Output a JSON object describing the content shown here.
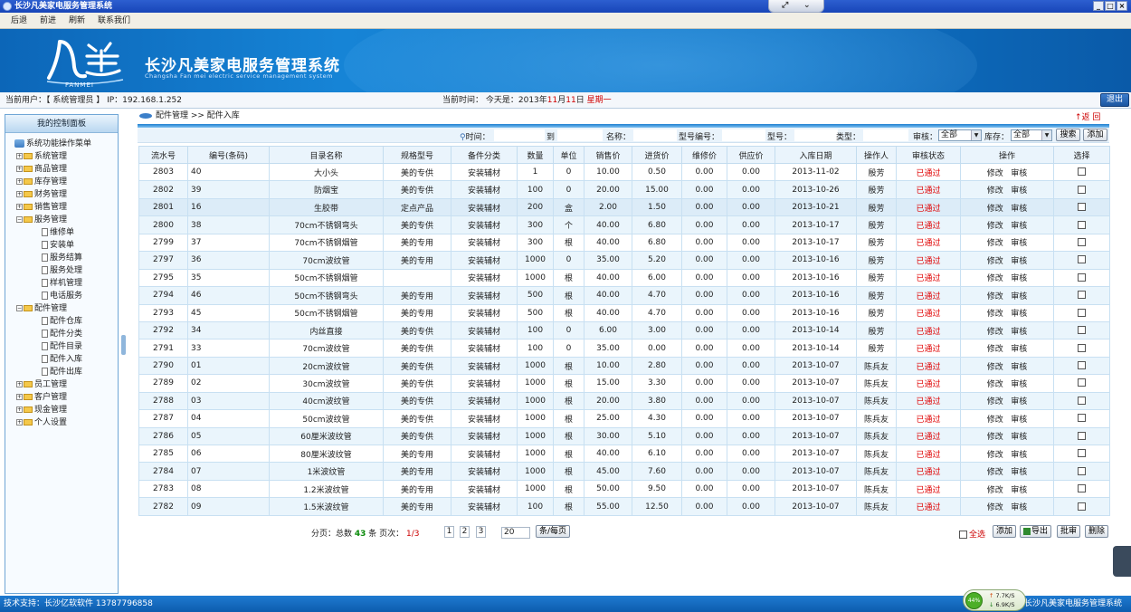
{
  "window": {
    "title": "长沙凡美家电服务管理系统",
    "controls": [
      "_",
      "□",
      "×"
    ]
  },
  "menu": [
    "后退",
    "前进",
    "刷新",
    "联系我们"
  ],
  "banner": {
    "logo_text": "凡美",
    "logo_sub": "FANMEI",
    "title": "长沙凡美家电服务管理系统",
    "subtitle": "Changsha Fan mei electric service management system"
  },
  "info": {
    "user_label": "当前用户：【 系统管理员 】 IP：192.168.1.252",
    "time_prefix": "当前时间：   今天是：2013年",
    "month": "11",
    "mid": "月",
    "day": "11",
    "suffix": "日",
    "weekday": "星期一",
    "logout": "退出"
  },
  "sidebar": {
    "header": "我的控制面板",
    "root": "系统功能操作菜单",
    "groups": [
      {
        "label": "系统管理",
        "expanded": false
      },
      {
        "label": "商品管理",
        "expanded": false
      },
      {
        "label": "库存管理",
        "expanded": false
      },
      {
        "label": "财务管理",
        "expanded": false
      },
      {
        "label": "销售管理",
        "expanded": false
      },
      {
        "label": "服务管理",
        "expanded": true,
        "children": [
          "维修单",
          "安装单",
          "服务结算",
          "服务处理",
          "样机管理",
          "电话服务"
        ]
      },
      {
        "label": "配件管理",
        "expanded": true,
        "children": [
          "配件仓库",
          "配件分类",
          "配件目录",
          "配件入库",
          "配件出库"
        ]
      },
      {
        "label": "员工管理",
        "expanded": false
      },
      {
        "label": "客户管理",
        "expanded": false
      },
      {
        "label": "现金管理",
        "expanded": false
      },
      {
        "label": "个人设置",
        "expanded": false
      }
    ]
  },
  "breadcrumb": "配件管理 >> 配件入库",
  "back": "↑返 回",
  "filters": {
    "time_label": "时间：",
    "to_label": "到",
    "name_label": "名称：",
    "model_no_label": "型号编号：",
    "model_label": "型号：",
    "type_label": "类型：",
    "audit_label": "审核：",
    "audit_value": "全部",
    "stock_label": "库存：",
    "stock_value": "全部",
    "search_btn": "搜索",
    "add_btn": "添加"
  },
  "table": {
    "columns": [
      "流水号",
      "编号(条码)",
      "目录名称",
      "规格型号",
      "备件分类",
      "数量",
      "单位",
      "销售价",
      "进货价",
      "维修价",
      "供应价",
      "入库日期",
      "操作人",
      "审核状态",
      "操作",
      "选择"
    ],
    "rows": [
      [
        "2803",
        "40",
        "大小头",
        "美的专供",
        "安装辅材",
        "1",
        "0",
        "10.00",
        "0.50",
        "0.00",
        "0.00",
        "2013-11-02",
        "殷芳",
        "已通过"
      ],
      [
        "2802",
        "39",
        "防烟宝",
        "美的专供",
        "安装辅材",
        "100",
        "0",
        "20.00",
        "15.00",
        "0.00",
        "0.00",
        "2013-10-26",
        "殷芳",
        "已通过"
      ],
      [
        "2801",
        "16",
        "生胶带",
        "定点产品",
        "安装辅材",
        "200",
        "盒",
        "2.00",
        "1.50",
        "0.00",
        "0.00",
        "2013-10-21",
        "殷芳",
        "已通过"
      ],
      [
        "2800",
        "38",
        "70cm不锈钢弯头",
        "美的专供",
        "安装辅材",
        "300",
        "个",
        "40.00",
        "6.80",
        "0.00",
        "0.00",
        "2013-10-17",
        "殷芳",
        "已通过"
      ],
      [
        "2799",
        "37",
        "70cm不锈钢烟管",
        "美的专用",
        "安装辅材",
        "300",
        "根",
        "40.00",
        "6.80",
        "0.00",
        "0.00",
        "2013-10-17",
        "殷芳",
        "已通过"
      ],
      [
        "2797",
        "36",
        "70cm波纹管",
        "美的专用",
        "安装辅材",
        "1000",
        "0",
        "35.00",
        "5.20",
        "0.00",
        "0.00",
        "2013-10-16",
        "殷芳",
        "已通过"
      ],
      [
        "2795",
        "35",
        "50cm不锈钢烟管",
        "",
        "安装辅材",
        "1000",
        "根",
        "40.00",
        "6.00",
        "0.00",
        "0.00",
        "2013-10-16",
        "殷芳",
        "已通过"
      ],
      [
        "2794",
        "46",
        "50cm不锈钢弯头",
        "美的专用",
        "安装辅材",
        "500",
        "根",
        "40.00",
        "4.70",
        "0.00",
        "0.00",
        "2013-10-16",
        "殷芳",
        "已通过"
      ],
      [
        "2793",
        "45",
        "50cm不锈钢烟管",
        "美的专用",
        "安装辅材",
        "500",
        "根",
        "40.00",
        "4.70",
        "0.00",
        "0.00",
        "2013-10-16",
        "殷芳",
        "已通过"
      ],
      [
        "2792",
        "34",
        "内丝直接",
        "美的专供",
        "安装辅材",
        "100",
        "0",
        "6.00",
        "3.00",
        "0.00",
        "0.00",
        "2013-10-14",
        "殷芳",
        "已通过"
      ],
      [
        "2791",
        "33",
        "70cm波纹管",
        "美的专供",
        "安装辅材",
        "100",
        "0",
        "35.00",
        "0.00",
        "0.00",
        "0.00",
        "2013-10-14",
        "殷芳",
        "已通过"
      ],
      [
        "2790",
        "01",
        "20cm波纹管",
        "美的专供",
        "安装辅材",
        "1000",
        "根",
        "10.00",
        "2.80",
        "0.00",
        "0.00",
        "2013-10-07",
        "陈兵友",
        "已通过"
      ],
      [
        "2789",
        "02",
        "30cm波纹管",
        "美的专供",
        "安装辅材",
        "1000",
        "根",
        "15.00",
        "3.30",
        "0.00",
        "0.00",
        "2013-10-07",
        "陈兵友",
        "已通过"
      ],
      [
        "2788",
        "03",
        "40cm波纹管",
        "美的专供",
        "安装辅材",
        "1000",
        "根",
        "20.00",
        "3.80",
        "0.00",
        "0.00",
        "2013-10-07",
        "陈兵友",
        "已通过"
      ],
      [
        "2787",
        "04",
        "50cm波纹管",
        "美的专供",
        "安装辅材",
        "1000",
        "根",
        "25.00",
        "4.30",
        "0.00",
        "0.00",
        "2013-10-07",
        "陈兵友",
        "已通过"
      ],
      [
        "2786",
        "05",
        "60厘米波纹管",
        "美的专供",
        "安装辅材",
        "1000",
        "根",
        "30.00",
        "5.10",
        "0.00",
        "0.00",
        "2013-10-07",
        "陈兵友",
        "已通过"
      ],
      [
        "2785",
        "06",
        "80厘米波纹管",
        "美的专用",
        "安装辅材",
        "1000",
        "根",
        "40.00",
        "6.10",
        "0.00",
        "0.00",
        "2013-10-07",
        "陈兵友",
        "已通过"
      ],
      [
        "2784",
        "07",
        "1米波纹管",
        "美的专用",
        "安装辅材",
        "1000",
        "根",
        "45.00",
        "7.60",
        "0.00",
        "0.00",
        "2013-10-07",
        "陈兵友",
        "已通过"
      ],
      [
        "2783",
        "08",
        "1.2米波纹管",
        "美的专用",
        "安装辅材",
        "1000",
        "根",
        "50.00",
        "9.50",
        "0.00",
        "0.00",
        "2013-10-07",
        "陈兵友",
        "已通过"
      ],
      [
        "2782",
        "09",
        "1.5米波纹管",
        "美的专用",
        "安装辅材",
        "100",
        "根",
        "55.00",
        "12.50",
        "0.00",
        "0.00",
        "2013-10-07",
        "陈兵友",
        "已通过"
      ]
    ],
    "action_edit": "修改",
    "action_audit": "审核"
  },
  "pager": {
    "prefix": "分页：总数",
    "total": "43",
    "unit": "条 页次：",
    "page_of": "1/3",
    "pages": [
      "1",
      "2",
      "3"
    ],
    "per_page": "20",
    "per_page_label": "条/每页"
  },
  "bottom_actions": {
    "select_all": "全选",
    "add": "添加",
    "export": "导出",
    "batch_audit": "批审",
    "delete": "删除"
  },
  "status": {
    "support": "技术支持：长沙亿软软件 13787796858",
    "right_title": "长沙凡美家电服务管理系统",
    "cpu": "44%",
    "up": "7.7K/S",
    "down": "6.9K/S"
  },
  "colors": {
    "title_blue": "#1845b8",
    "banner_blue": "#1684d6",
    "status_red": "#e00000",
    "row_alt": "#eaf5fc"
  }
}
